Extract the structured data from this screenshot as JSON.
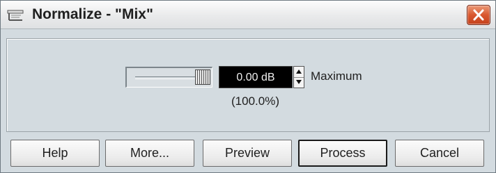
{
  "window": {
    "title": "Normalize - \"Mix\"",
    "icon": "app-icon",
    "close_icon": "close-icon",
    "close_color": "#d9582f"
  },
  "normalize": {
    "level_value": "0.00 dB",
    "level_fraction": 1.0,
    "mode_label": "Maximum",
    "percent": "(100.0%)"
  },
  "buttons": {
    "help": "Help",
    "more": "More...",
    "preview": "Preview",
    "process": "Process",
    "cancel": "Cancel"
  }
}
